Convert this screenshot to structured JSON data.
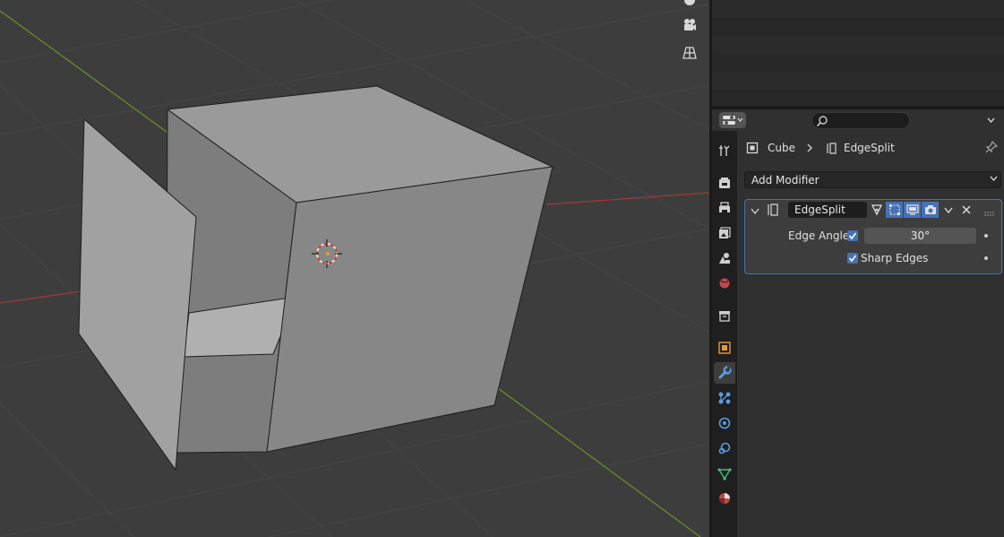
{
  "breadcrumb": {
    "object": "Cube",
    "modifier": "EdgeSplit"
  },
  "add_modifier": {
    "label": "Add Modifier"
  },
  "modifier": {
    "name": "EdgeSplit",
    "edge_angle_label": "Edge Angle",
    "edge_angle_checked": true,
    "edge_angle_value": "30°",
    "sharp_edges_checked": true,
    "sharp_edges_label": "Sharp Edges"
  },
  "search": {
    "placeholder": ""
  },
  "tabs": [
    "tool-icon",
    "render-icon",
    "output-icon",
    "view-layer-icon",
    "scene-icon",
    "world-icon",
    "collection-icon",
    "object-icon",
    "modifier-icon",
    "particles-icon",
    "physics-icon",
    "constraints-icon",
    "data-icon",
    "material-icon"
  ],
  "active_tab": "modifier-icon",
  "colors": {
    "accent": "#4772b3",
    "x_axis": "#a23a3a",
    "y_axis": "#6a8f2a",
    "panel": "#303030",
    "viewport": "#3d3d3d"
  }
}
